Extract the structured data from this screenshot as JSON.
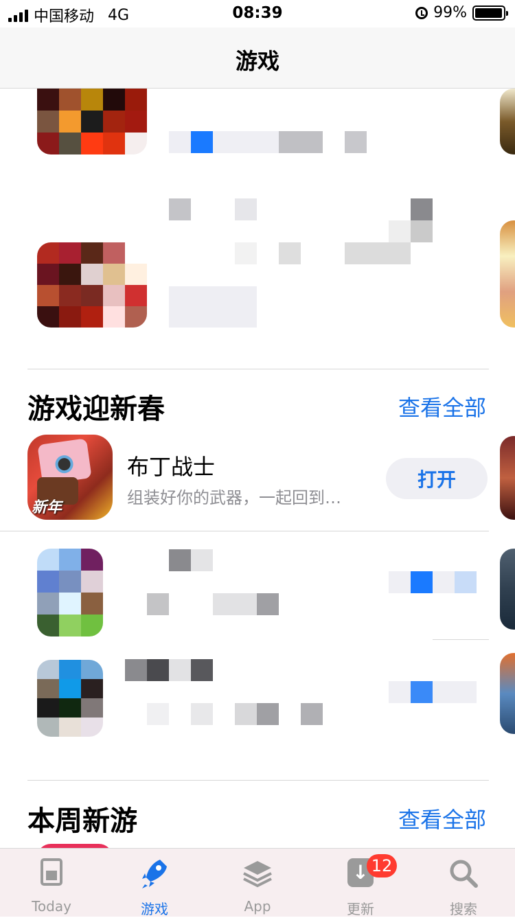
{
  "status_bar": {
    "carrier": "中国移动",
    "network": "4G",
    "time": "08:39",
    "battery": "99%"
  },
  "nav": {
    "title": "游戏"
  },
  "sections": [
    {
      "title": "游戏迎新春",
      "see_all": "查看全部"
    },
    {
      "title": "本周新游",
      "see_all": "查看全部"
    }
  ],
  "featured_app": {
    "name": "布丁战士",
    "subtitle": "组装好你的武器，一起回到…",
    "action": "打开",
    "icon_caption": "新年",
    "icon": "game-robot-icon"
  },
  "tabs": [
    {
      "label": "Today",
      "icon": "today-icon"
    },
    {
      "label": "游戏",
      "icon": "rocket-icon",
      "active": true
    },
    {
      "label": "App",
      "icon": "layers-icon"
    },
    {
      "label": "更新",
      "icon": "update-icon",
      "badge": "12"
    },
    {
      "label": "搜索",
      "icon": "search-icon"
    }
  ],
  "colors": {
    "accent": "#1a73e8",
    "badge": "#ff3b30"
  }
}
